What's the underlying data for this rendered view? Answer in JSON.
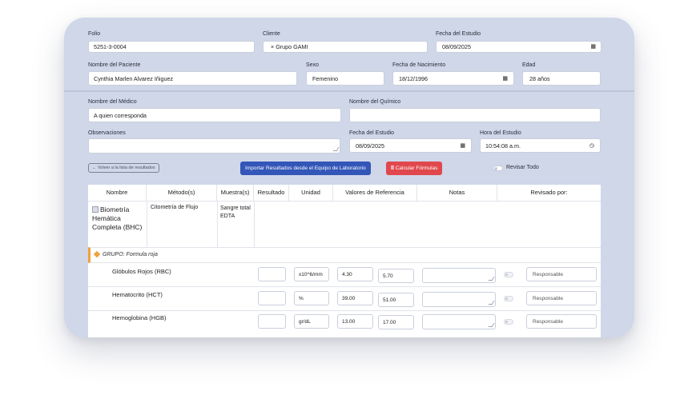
{
  "form": {
    "folio": {
      "label": "Folio",
      "value": "5251-3-0004"
    },
    "cliente": {
      "label": "Cliente",
      "value": "× Grupo GAMI"
    },
    "fecha_estudio_top": {
      "label": "Fecha del Estudio",
      "value": "08/09/2025"
    },
    "paciente": {
      "label": "Nombre del Paciente",
      "value": "Cynthia Marlen Alvarez Iñiguez"
    },
    "sexo": {
      "label": "Sexo",
      "value": "Femenino"
    },
    "nacimiento": {
      "label": "Fecha de Nacimiento",
      "value": "18/12/1996"
    },
    "edad": {
      "label": "Edad",
      "value": "28 años"
    },
    "medico": {
      "label": "Nombre del Médico",
      "value": "A quien corresponda"
    },
    "quimico": {
      "label": "Nombre del Químico",
      "value": ""
    },
    "observaciones": {
      "label": "Observaciones",
      "value": ""
    },
    "fecha_estudio": {
      "label": "Fecha del Estudio",
      "value": "08/09/2025"
    },
    "hora_estudio": {
      "label": "Hora del Estudio",
      "value": "10:54:08 a.m."
    }
  },
  "actions": {
    "back": "← Volver a la lista de resultados",
    "import": "Importar Resultados desde el Equipo de Laboratorio",
    "calc": "🖩 Calcular Fórmulas",
    "review_all": "Revisar Todo"
  },
  "table": {
    "headers": [
      "Nombre",
      "Método(s)",
      "Muestra(s)",
      "Resultado",
      "Unidad",
      "Valores de Referencia",
      "Notas",
      "Revisado por:"
    ],
    "study": {
      "name": "Biometría Hemática Completa (BHC)",
      "method": "Citometría de Flujo",
      "sample": "Sangre total EDTA"
    },
    "group_label": "GRUPO: Formula roja",
    "rows": [
      {
        "name": "Glóbulos Rojos (RBC)",
        "unit": "x10^6/mm",
        "ref_min": "4.30",
        "ref_max": "5.70",
        "reviewer": "Responsable"
      },
      {
        "name": "Hematocrito (HCT)",
        "unit": "%",
        "ref_min": "39.00",
        "ref_max": "51.00",
        "reviewer": "Responsable"
      },
      {
        "name": "Hemoglobina (HGB)",
        "unit": "gr/dL",
        "ref_min": "13.00",
        "ref_max": "17.00",
        "reviewer": "Responsable"
      }
    ]
  },
  "colors": {
    "primary": "#3356b8",
    "danger": "#e0484d",
    "background": "#cfd7e9"
  },
  "icons": [
    "calendar-icon",
    "clock-icon",
    "calculator-icon",
    "document-icon",
    "diamond-icon"
  ]
}
